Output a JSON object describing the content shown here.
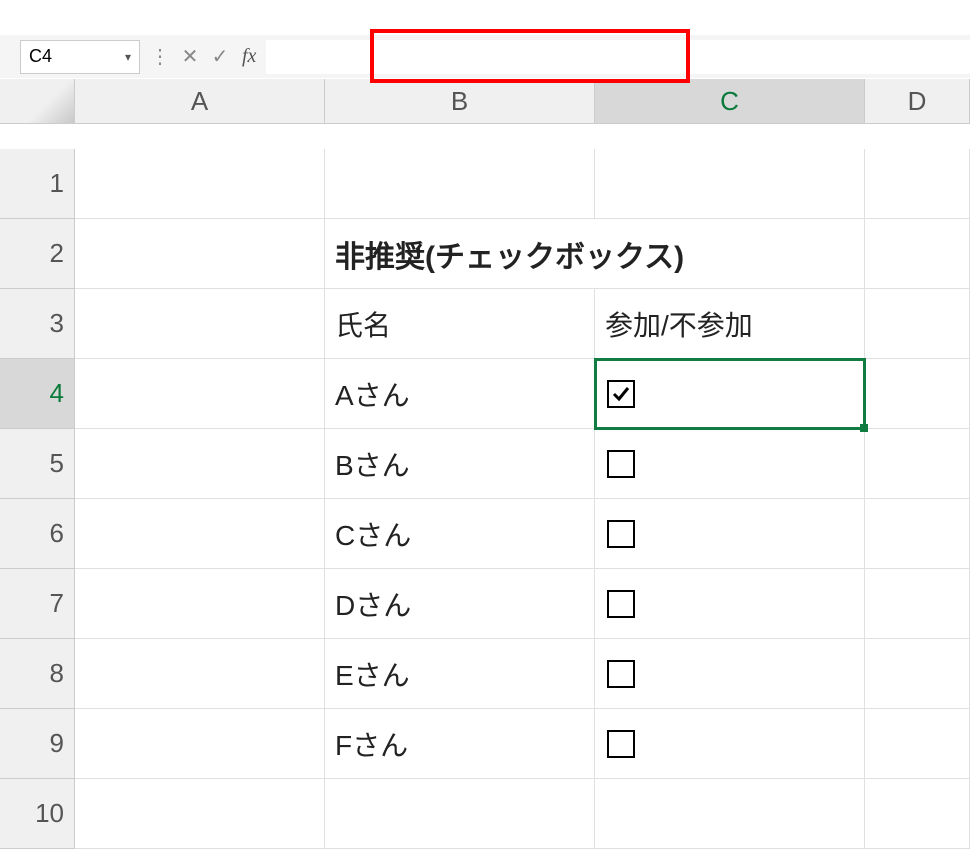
{
  "name_box": {
    "value": "C4"
  },
  "formula_bar": {
    "value": ""
  },
  "fx_label": "fx",
  "columns": [
    "A",
    "B",
    "C",
    "D"
  ],
  "row_numbers": [
    "1",
    "2",
    "3",
    "4",
    "5",
    "6",
    "7",
    "8",
    "9",
    "10"
  ],
  "active_cell": {
    "row": 4,
    "col": "C"
  },
  "title_cell": {
    "row": 2,
    "col": "B",
    "text": "非推奨(チェックボックス)"
  },
  "header_row": {
    "row": 3,
    "name_label": "氏名",
    "attend_label": "参加/不参加"
  },
  "names": [
    {
      "row": 4,
      "name": "Aさん",
      "checked": true
    },
    {
      "row": 5,
      "name": "Bさん",
      "checked": false
    },
    {
      "row": 6,
      "name": "Cさん",
      "checked": false
    },
    {
      "row": 7,
      "name": "Dさん",
      "checked": false
    },
    {
      "row": 8,
      "name": "Eさん",
      "checked": false
    },
    {
      "row": 9,
      "name": "Fさん",
      "checked": false
    }
  ],
  "highlight_box": true
}
